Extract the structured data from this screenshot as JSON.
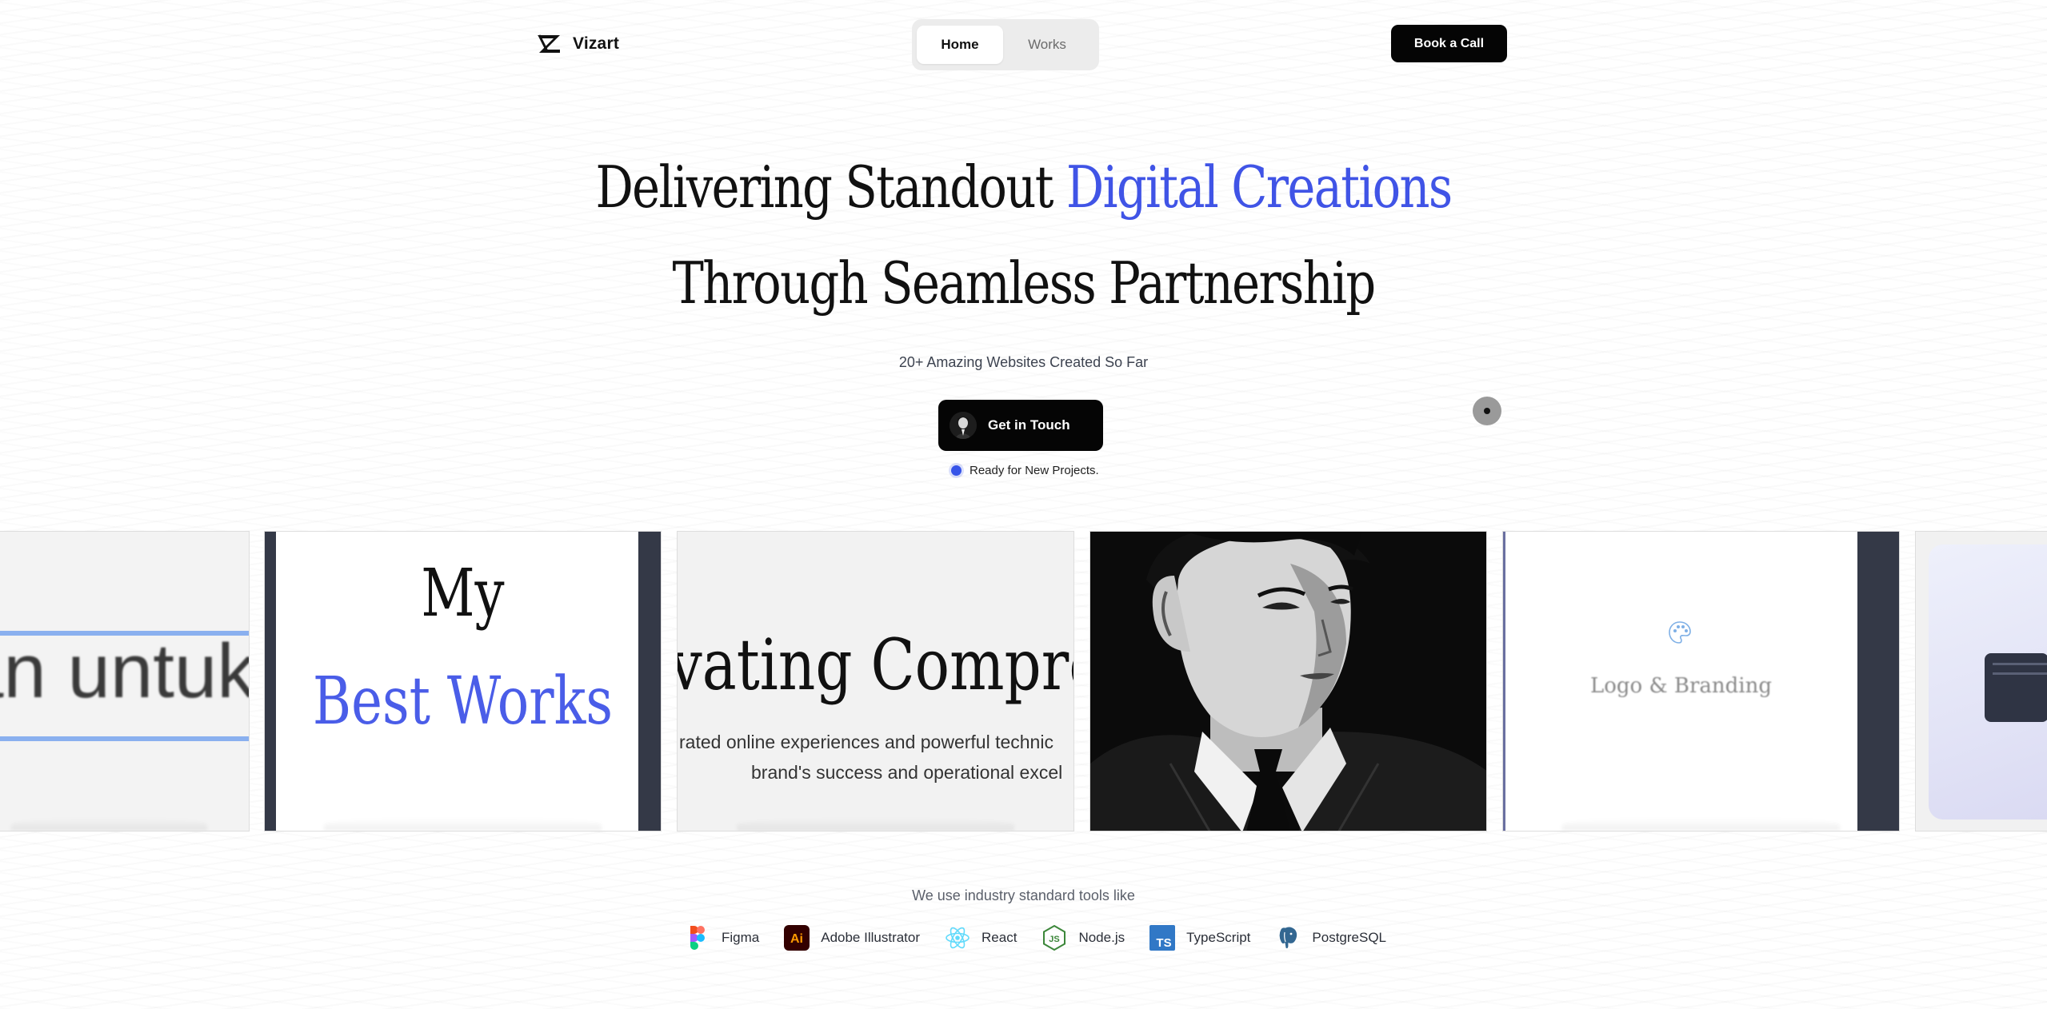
{
  "brand": {
    "name": "Vizart"
  },
  "nav": {
    "tabs": [
      {
        "label": "Home",
        "active": true
      },
      {
        "label": "Works",
        "active": false
      }
    ],
    "cta_label": "Book a Call"
  },
  "hero": {
    "line1_plain": "Delivering Standout ",
    "line1_accent": "Digital Creations",
    "line2": "Through Seamless Partnership",
    "accent_color": "#4054e6",
    "subtitle": "20+ Amazing Websites Created So Far",
    "cta_label": "Get in Touch",
    "status_text": "Ready for New Projects.",
    "status_color": "#3654e8"
  },
  "carousel": {
    "cards": [
      {
        "text": "an untuk"
      },
      {
        "line1": "My",
        "line2": "Best Works"
      },
      {
        "title": "vating Compreh",
        "sub1": "rated online experiences and powerful technic",
        "sub2": "brand's success and operational excel"
      },
      {
        "kind": "portrait-illustration"
      },
      {
        "icon": "palette-icon",
        "label": "Logo & Branding"
      },
      {
        "kind": "ui-preview"
      }
    ]
  },
  "tools": {
    "caption": "We use industry standard tools like",
    "items": [
      {
        "label": "Figma",
        "icon": "figma-icon"
      },
      {
        "label": "Adobe Illustrator",
        "icon": "adobe-illustrator-icon"
      },
      {
        "label": "React",
        "icon": "react-icon"
      },
      {
        "label": "Node.js",
        "icon": "nodejs-icon"
      },
      {
        "label": "TypeScript",
        "icon": "typescript-icon"
      },
      {
        "label": "PostgreSQL",
        "icon": "postgresql-icon"
      }
    ]
  }
}
